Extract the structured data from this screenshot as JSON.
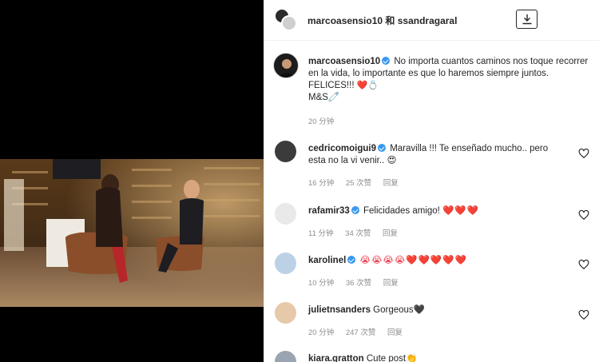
{
  "header": {
    "title": "marcoasensio10 和 ssandragaral",
    "icons": {
      "download": "download-icon"
    }
  },
  "caption": {
    "username": "marcoasensio10",
    "text": "No importa cuantos caminos nos toque recorrer en la vida, lo importante es que lo haremos siempre juntos. FELICES!!!",
    "emojis": "❤️💍",
    "signature": "M&S🧷",
    "time": "20 分钟"
  },
  "comments": [
    {
      "username": "cedricomoigui9",
      "verified": true,
      "text": "Maravilla !!! Te enseñado mucho.. pero esta no la vi venir..",
      "emoji": "😍",
      "time": "16 分钟",
      "likes": "25 次赞",
      "reply": "回复"
    },
    {
      "username": "rafamir33",
      "verified": true,
      "text": "Felicidades amigo!",
      "emoji": "❤️❤️❤️",
      "time": "11 分钟",
      "likes": "34 次赞",
      "reply": "回复"
    },
    {
      "username": "karolinel",
      "verified": true,
      "text": "",
      "emoji": "😭😭😭😭❤️❤️❤️❤️❤️",
      "time": "10 分钟",
      "likes": "36 次赞",
      "reply": "回复"
    },
    {
      "username": "julietnsanders",
      "verified": false,
      "text": "Gorgeous",
      "emoji": "🖤",
      "time": "20 分钟",
      "likes": "247 次赞",
      "reply": "回复"
    },
    {
      "username": "kiara.gratton",
      "verified": false,
      "text": "Cute post",
      "emoji": "👏",
      "time": "",
      "likes": "",
      "reply": ""
    }
  ],
  "colors": {
    "verified": "#3897f0",
    "heart": "#ed4956",
    "meta": "#8e8e8e"
  }
}
